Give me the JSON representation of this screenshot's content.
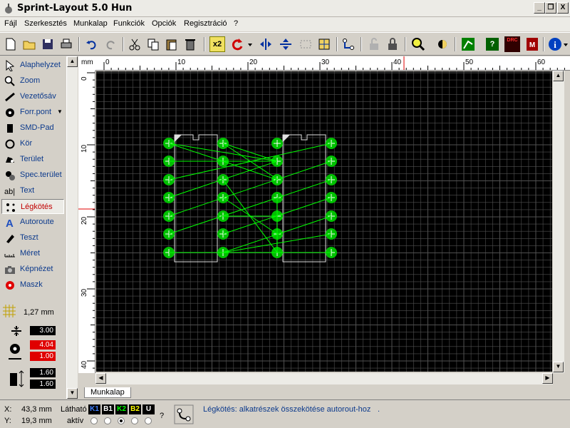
{
  "window": {
    "title": "Sprint-Layout 5.0 Hun",
    "minimize": "_",
    "restore": "❐",
    "close": "X"
  },
  "menu": [
    "Fájl",
    "Szerkesztés",
    "Munkalap",
    "Funkciók",
    "Opciók",
    "Regisztráció",
    "?"
  ],
  "toolbar": {
    "zoom_badge": "x2",
    "drc_label": "DRC"
  },
  "tools": [
    {
      "label": "Alaphelyzet",
      "icon": "cursor-arrow-icon"
    },
    {
      "label": "Zoom",
      "icon": "zoom-icon"
    },
    {
      "label": "Vezetősáv",
      "icon": "track-icon"
    },
    {
      "label": "Forr.pont",
      "icon": "pad-icon"
    },
    {
      "label": "SMD-Pad",
      "icon": "smd-pad-icon"
    },
    {
      "label": "Kör",
      "icon": "circle-icon"
    },
    {
      "label": "Terület",
      "icon": "zone-icon"
    },
    {
      "label": "Spec.terület",
      "icon": "special-zone-icon"
    },
    {
      "label": "Text",
      "icon": "text-icon"
    },
    {
      "label": "Légkötés",
      "icon": "airwire-icon",
      "active": true
    },
    {
      "label": "Autoroute",
      "icon": "autoroute-icon"
    },
    {
      "label": "Teszt",
      "icon": "test-icon"
    },
    {
      "label": "Méret",
      "icon": "measure-icon"
    },
    {
      "label": "Képnézet",
      "icon": "camera-icon"
    },
    {
      "label": "Maszk",
      "icon": "mask-icon"
    }
  ],
  "settings": {
    "grid": "1,27 mm",
    "track_width": "3.00",
    "pad_outer": "4.04",
    "pad_inner": "1.00",
    "smd_w": "1.60",
    "smd_h": "1.60"
  },
  "ruler": {
    "units": "mm",
    "h_labels": [
      "0",
      "10",
      "20",
      "30",
      "40",
      "50",
      "60"
    ],
    "v_labels": [
      "0",
      "10",
      "20",
      "30",
      "40"
    ]
  },
  "tab": "Munkalap",
  "status": {
    "x_label": "X:",
    "x_value": "43,3 mm",
    "y_label": "Y:",
    "y_value": "19,3 mm",
    "visible_label": "Látható",
    "layers": [
      "K1",
      "B1",
      "K2",
      "B2",
      "U"
    ],
    "active_label": "aktív",
    "help_mark": "?",
    "message": "Légkötés: alkatrészek összekötése autorout-hoz",
    "message_dot": "."
  },
  "colors": {
    "board_bg": "#000000",
    "grid": "#505050",
    "pad": "#00c000",
    "airwire": "#00ff00",
    "outline": "#e0e0e0",
    "k1": "#4080ff",
    "b1": "#ffffff",
    "k2": "#00ff00",
    "b2": "#ffff00",
    "u": "#ffffff"
  }
}
